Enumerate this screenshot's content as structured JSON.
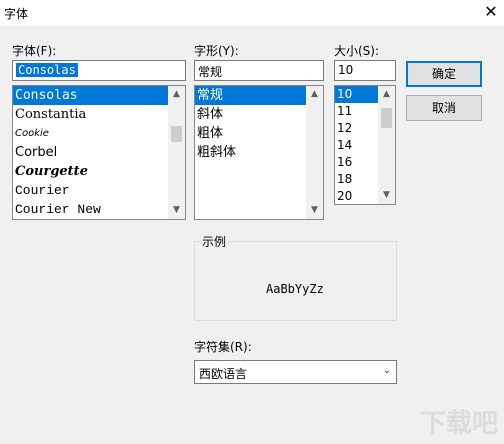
{
  "window": {
    "title": "字体",
    "close_glyph": "✕"
  },
  "font": {
    "label": "字体(F):",
    "value": "Consolas",
    "items": [
      "Consolas",
      "Constantia",
      "Cookie",
      "Corbel",
      "Courgette",
      "Courier",
      "Courier New"
    ]
  },
  "style": {
    "label": "字形(Y):",
    "value": "常规",
    "items": [
      "常规",
      "斜体",
      "粗体",
      "粗斜体"
    ]
  },
  "size": {
    "label": "大小(S):",
    "value": "10",
    "items": [
      "10",
      "11",
      "12",
      "14",
      "16",
      "18",
      "20"
    ]
  },
  "buttons": {
    "ok": "确定",
    "cancel": "取消"
  },
  "sample": {
    "label": "示例",
    "text": "AaBbYyZz"
  },
  "charset": {
    "label": "字符集(R):",
    "value": "西欧语言"
  },
  "watermark": "下载吧",
  "colors": {
    "selection": "#0078d7"
  }
}
